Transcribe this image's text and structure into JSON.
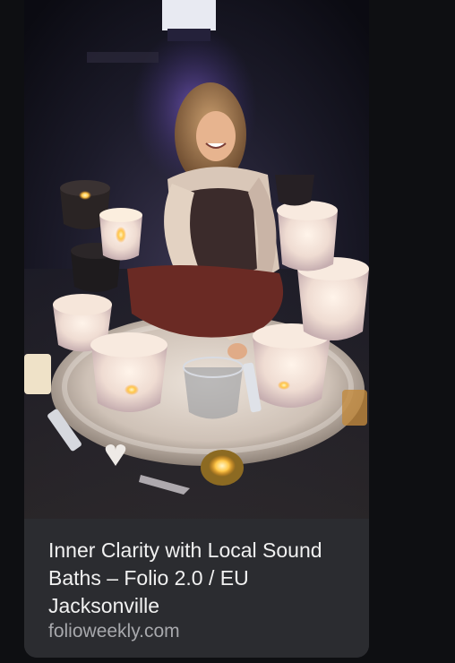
{
  "result": {
    "title": "Inner Clarity with Local Sound Baths – Folio 2.0 / EU Jacksonville",
    "source": "folioweekly.com",
    "image_alt": "Woman seated on a white rug surrounded by crystal singing bowls and candles"
  },
  "colors": {
    "page_background": "#0e0f12",
    "caption_background": "#2b2c30",
    "title_text": "#f1f1f1",
    "source_text": "#a7a8ac"
  }
}
